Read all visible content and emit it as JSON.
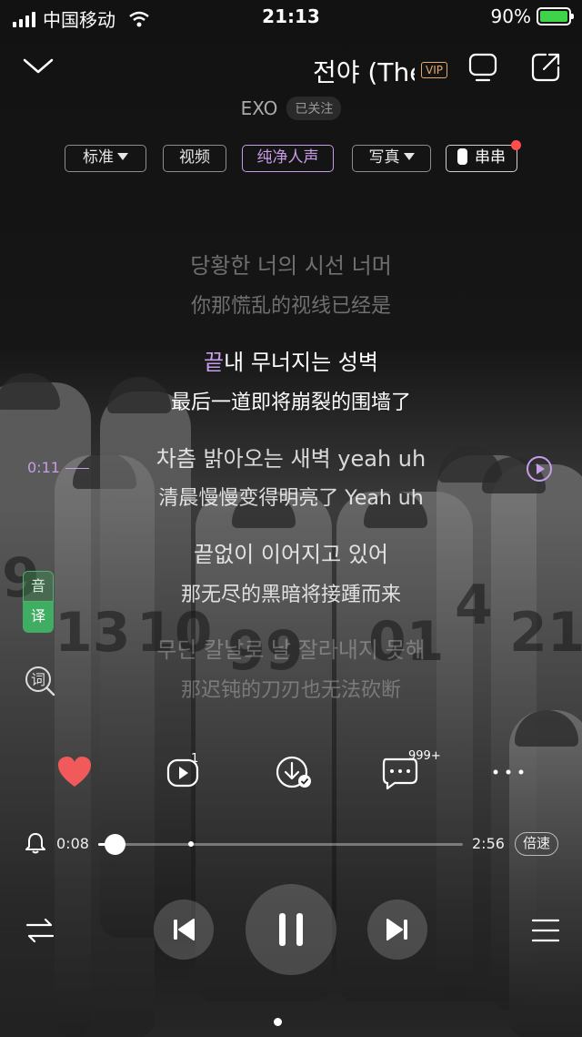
{
  "status_bar": {
    "carrier": "中国移动",
    "time": "21:13",
    "battery": "90%"
  },
  "header": {
    "song_title": "전야 (The",
    "vip_badge": "VIP",
    "artist": "EXO",
    "follow_label": "已关注"
  },
  "tags": [
    {
      "label": "标准"
    },
    {
      "label": "视频"
    },
    {
      "label": "纯净人声"
    },
    {
      "label": "写真"
    },
    {
      "label": "串串"
    }
  ],
  "lyrics": [
    {
      "kr": "당황한 너의 시선 너머",
      "cn": "你那慌乱的视线已经是"
    },
    {
      "kr_hl": "끝",
      "kr_rest": "내 무너지는 성벽",
      "cn": "最后一道即将崩裂的围墙了"
    },
    {
      "kr": "차츰 밝아오는 새벽 yeah uh",
      "cn": "清晨慢慢变得明亮了 Yeah uh"
    },
    {
      "kr": "끝없이 이어지고 있어",
      "cn": "那无尽的黑暗将接踵而来"
    },
    {
      "kr": "무딘 칼날로 날 잘라내지 못해",
      "cn": "那迟钝的刀刃也无法砍断"
    }
  ],
  "lyric_side_time": "0:11",
  "translate_toggle": {
    "top": "音",
    "bottom": "译"
  },
  "ci_label": "词",
  "actions": {
    "playlist_badge": "1",
    "comments_badge": "999+"
  },
  "progress": {
    "current": "0:08",
    "total": "2:56",
    "played_fraction": 0.045,
    "marker_fraction": 0.255,
    "speed_label": "倍速"
  },
  "colors": {
    "accent": "#c79ce8",
    "like": "#f05a5a",
    "translate_green": "#3fae62",
    "vip": "#e6a86a"
  },
  "icons": {
    "back": "chevron-down-icon",
    "device": "screen-cast-icon",
    "share": "share-icon",
    "like": "heart-icon",
    "playlist": "add-to-playlist-icon",
    "download": "download-done-icon",
    "comments": "comment-icon",
    "more": "more-icon",
    "timer": "bell-icon",
    "mode": "shuffle-icon",
    "prev": "skip-previous-icon",
    "pause": "pause-icon",
    "next": "skip-next-icon",
    "queue": "queue-icon"
  }
}
